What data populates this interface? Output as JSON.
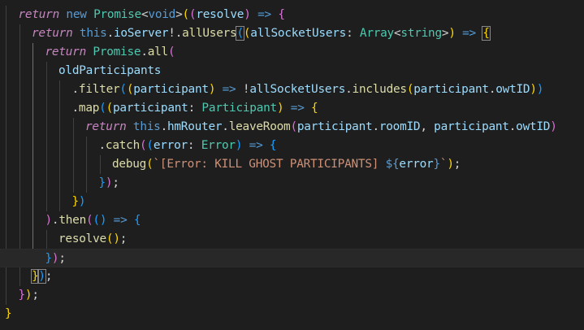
{
  "editor": {
    "current_line": 13,
    "lines": [
      {
        "indent": 1,
        "tokens": [
          {
            "t": "return",
            "c": "kw-ctrl"
          },
          {
            "t": " ",
            "c": "punc"
          },
          {
            "t": "new",
            "c": "kw"
          },
          {
            "t": " ",
            "c": "punc"
          },
          {
            "t": "Promise",
            "c": "type"
          },
          {
            "t": "<",
            "c": "punc"
          },
          {
            "t": "void",
            "c": "kw"
          },
          {
            "t": ">",
            "c": "punc"
          },
          {
            "t": "(",
            "c": "b1"
          },
          {
            "t": "(",
            "c": "b2"
          },
          {
            "t": "resolve",
            "c": "var"
          },
          {
            "t": ")",
            "c": "b2"
          },
          {
            "t": " => ",
            "c": "kw"
          },
          {
            "t": "{",
            "c": "b2"
          }
        ]
      },
      {
        "indent": 2,
        "tokens": [
          {
            "t": "return",
            "c": "kw-ctrl"
          },
          {
            "t": " ",
            "c": "punc"
          },
          {
            "t": "this",
            "c": "kw"
          },
          {
            "t": ".",
            "c": "punc"
          },
          {
            "t": "ioServer",
            "c": "var"
          },
          {
            "t": "!.",
            "c": "punc"
          },
          {
            "t": "allUsers",
            "c": "fn"
          },
          {
            "t": "(",
            "c": "b3 bm"
          },
          {
            "t": "(",
            "c": "b1"
          },
          {
            "t": "allSocketUsers",
            "c": "var"
          },
          {
            "t": ": ",
            "c": "punc"
          },
          {
            "t": "Array",
            "c": "type"
          },
          {
            "t": "<",
            "c": "punc"
          },
          {
            "t": "string",
            "c": "type"
          },
          {
            "t": ">",
            "c": "punc"
          },
          {
            "t": ")",
            "c": "b1"
          },
          {
            "t": " => ",
            "c": "kw"
          },
          {
            "t": "{",
            "c": "b1 bm"
          }
        ]
      },
      {
        "indent": 3,
        "tokens": [
          {
            "t": "return",
            "c": "kw-ctrl"
          },
          {
            "t": " ",
            "c": "punc"
          },
          {
            "t": "Promise",
            "c": "type"
          },
          {
            "t": ".",
            "c": "punc"
          },
          {
            "t": "all",
            "c": "fn"
          },
          {
            "t": "(",
            "c": "b2"
          }
        ]
      },
      {
        "indent": 4,
        "tokens": [
          {
            "t": "oldParticipants",
            "c": "var"
          }
        ]
      },
      {
        "indent": 5,
        "tokens": [
          {
            "t": ".",
            "c": "punc"
          },
          {
            "t": "filter",
            "c": "fn"
          },
          {
            "t": "(",
            "c": "b3"
          },
          {
            "t": "(",
            "c": "b1"
          },
          {
            "t": "participant",
            "c": "var"
          },
          {
            "t": ")",
            "c": "b1"
          },
          {
            "t": " => ",
            "c": "kw"
          },
          {
            "t": "!",
            "c": "punc"
          },
          {
            "t": "allSocketUsers",
            "c": "var"
          },
          {
            "t": ".",
            "c": "punc"
          },
          {
            "t": "includes",
            "c": "fn"
          },
          {
            "t": "(",
            "c": "b1"
          },
          {
            "t": "participant",
            "c": "var"
          },
          {
            "t": ".",
            "c": "punc"
          },
          {
            "t": "owtID",
            "c": "var"
          },
          {
            "t": ")",
            "c": "b1"
          },
          {
            "t": ")",
            "c": "b3"
          }
        ]
      },
      {
        "indent": 5,
        "tokens": [
          {
            "t": ".",
            "c": "punc"
          },
          {
            "t": "map",
            "c": "fn"
          },
          {
            "t": "(",
            "c": "b3"
          },
          {
            "t": "(",
            "c": "b1"
          },
          {
            "t": "participant",
            "c": "var"
          },
          {
            "t": ": ",
            "c": "punc"
          },
          {
            "t": "Participant",
            "c": "type"
          },
          {
            "t": ")",
            "c": "b1"
          },
          {
            "t": " => ",
            "c": "kw"
          },
          {
            "t": "{",
            "c": "b1"
          }
        ]
      },
      {
        "indent": 6,
        "tokens": [
          {
            "t": "return",
            "c": "kw-ctrl"
          },
          {
            "t": " ",
            "c": "punc"
          },
          {
            "t": "this",
            "c": "kw"
          },
          {
            "t": ".",
            "c": "punc"
          },
          {
            "t": "hmRouter",
            "c": "var"
          },
          {
            "t": ".",
            "c": "punc"
          },
          {
            "t": "leaveRoom",
            "c": "fn"
          },
          {
            "t": "(",
            "c": "b2"
          },
          {
            "t": "participant",
            "c": "var"
          },
          {
            "t": ".",
            "c": "punc"
          },
          {
            "t": "roomID",
            "c": "var"
          },
          {
            "t": ", ",
            "c": "punc"
          },
          {
            "t": "participant",
            "c": "var"
          },
          {
            "t": ".",
            "c": "punc"
          },
          {
            "t": "owtID",
            "c": "var"
          },
          {
            "t": ")",
            "c": "b2"
          }
        ]
      },
      {
        "indent": 7,
        "tokens": [
          {
            "t": ".",
            "c": "punc"
          },
          {
            "t": "catch",
            "c": "fn"
          },
          {
            "t": "(",
            "c": "b2"
          },
          {
            "t": "(",
            "c": "b3"
          },
          {
            "t": "error",
            "c": "var"
          },
          {
            "t": ": ",
            "c": "punc"
          },
          {
            "t": "Error",
            "c": "type"
          },
          {
            "t": ")",
            "c": "b3"
          },
          {
            "t": " => ",
            "c": "kw"
          },
          {
            "t": "{",
            "c": "b3"
          }
        ]
      },
      {
        "indent": 8,
        "tokens": [
          {
            "t": "debug",
            "c": "fn"
          },
          {
            "t": "(",
            "c": "b1"
          },
          {
            "t": "`[Error: KILL GHOST PARTICIPANTS] ",
            "c": "str"
          },
          {
            "t": "${",
            "c": "tpl"
          },
          {
            "t": "error",
            "c": "var"
          },
          {
            "t": "}",
            "c": "tpl"
          },
          {
            "t": "`",
            "c": "str"
          },
          {
            "t": ")",
            "c": "b1"
          },
          {
            "t": ";",
            "c": "punc"
          }
        ]
      },
      {
        "indent": 7,
        "tokens": [
          {
            "t": "}",
            "c": "b3"
          },
          {
            "t": ")",
            "c": "b2"
          },
          {
            "t": ";",
            "c": "punc"
          }
        ]
      },
      {
        "indent": 5,
        "tokens": [
          {
            "t": "}",
            "c": "b1"
          },
          {
            "t": ")",
            "c": "b3"
          }
        ]
      },
      {
        "indent": 3,
        "tokens": [
          {
            "t": ")",
            "c": "b2"
          },
          {
            "t": ".",
            "c": "punc"
          },
          {
            "t": "then",
            "c": "fn"
          },
          {
            "t": "(",
            "c": "b2"
          },
          {
            "t": "(",
            "c": "b3"
          },
          {
            "t": ")",
            "c": "b3"
          },
          {
            "t": " => ",
            "c": "kw"
          },
          {
            "t": "{",
            "c": "b3"
          }
        ]
      },
      {
        "indent": 4,
        "tokens": [
          {
            "t": "resolve",
            "c": "fn"
          },
          {
            "t": "(",
            "c": "b1"
          },
          {
            "t": ")",
            "c": "b1"
          },
          {
            "t": ";",
            "c": "punc"
          }
        ]
      },
      {
        "indent": 3,
        "tokens": [
          {
            "t": "}",
            "c": "b3"
          },
          {
            "t": ")",
            "c": "b2"
          },
          {
            "t": ";",
            "c": "punc"
          }
        ]
      },
      {
        "indent": 2,
        "tokens": [
          {
            "t": "}",
            "c": "b1 bm"
          },
          {
            "t": ")",
            "c": "b3 bm"
          },
          {
            "t": ";",
            "c": "punc"
          }
        ]
      },
      {
        "indent": 1,
        "tokens": [
          {
            "t": "}",
            "c": "b2"
          },
          {
            "t": ")",
            "c": "b1"
          },
          {
            "t": ";",
            "c": "punc"
          }
        ]
      },
      {
        "indent": 0,
        "tokens": [
          {
            "t": "}",
            "c": "b1"
          }
        ]
      }
    ]
  }
}
